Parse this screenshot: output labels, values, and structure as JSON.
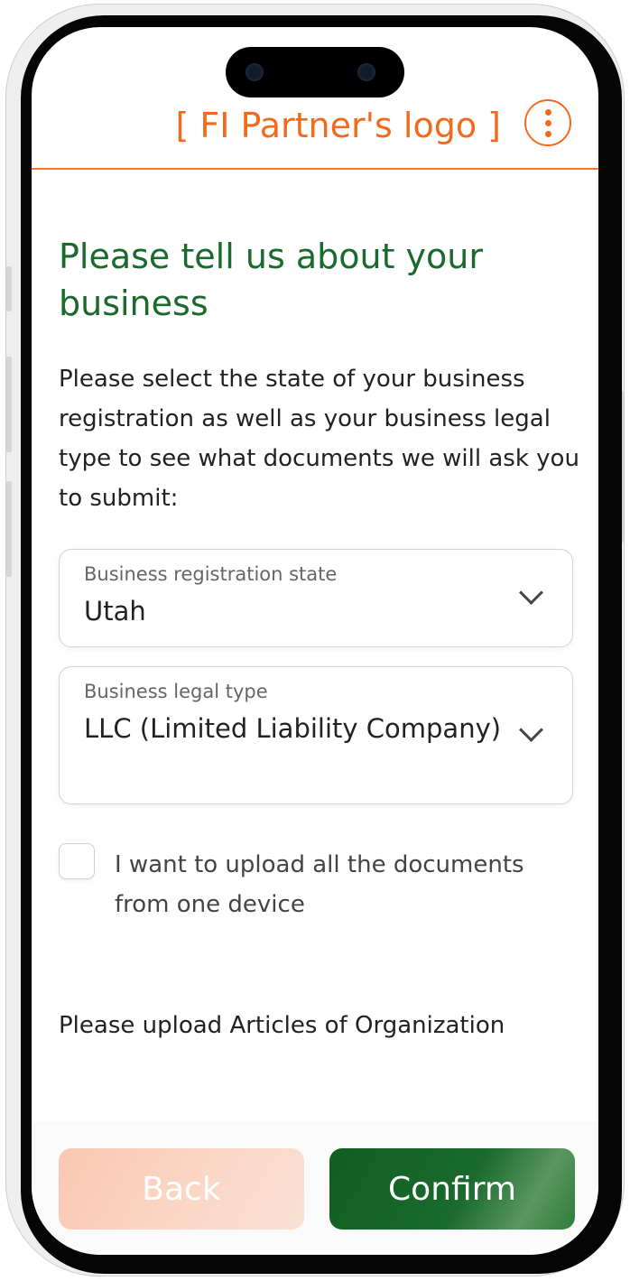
{
  "header": {
    "logo_text": "[ FI Partner's logo ]",
    "menu_icon": "more-vertical-icon",
    "accent_color": "#f26b1d"
  },
  "main": {
    "title": "Please tell us about your business",
    "intro": "Please select the state of your business registration as well as your business legal type to see what documents we will ask you to submit:",
    "registration_state": {
      "label": "Business registration state",
      "value": "Utah",
      "icon": "chevron-down-icon"
    },
    "legal_type": {
      "label": "Business legal type",
      "value": "LLC (Limited Liability Company)",
      "icon": "chevron-down-icon"
    },
    "single_device": {
      "label": "I want to upload all the documents from one device",
      "checked": false
    },
    "upload_heading": "Please upload Articles of Organization",
    "title_color": "#1b6a2d"
  },
  "footer": {
    "back_label": "Back",
    "confirm_label": "Confirm",
    "back_color": "#fbd0bd",
    "confirm_color": "#1b6a2d"
  }
}
